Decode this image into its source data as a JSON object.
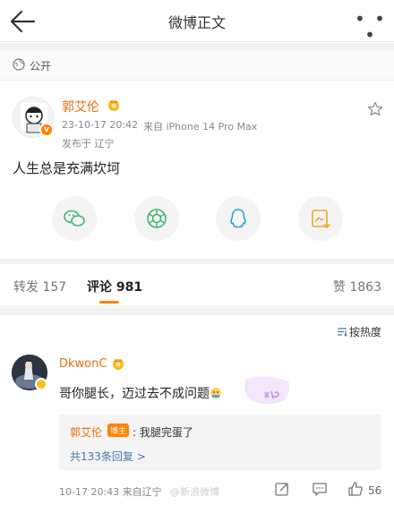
{
  "navbar": {
    "title": "微博正文",
    "more": "• • •"
  },
  "visibility": {
    "label": "公开"
  },
  "post": {
    "author": "郭艾伦",
    "time": "23-10-17 20:42",
    "source": "来自 iPhone 14 Pro Max",
    "location": "发布于 辽宁",
    "text": "人生总是充满坎坷",
    "share_icons": [
      "wechat-icon",
      "moments-icon",
      "qq-icon",
      "album-icon"
    ]
  },
  "tabs": {
    "repost": "转发 157",
    "comments": "评论 981",
    "likes": "赞 1863"
  },
  "sort": {
    "label": "按热度"
  },
  "comment": {
    "author": "DkwonC",
    "text": "哥你腿长，迈过去不成问题",
    "reply": {
      "author": "郭艾伦",
      "badge": "博主",
      "text": ": 我腿完蛋了",
      "more": "共133条回复 >"
    },
    "time": "10-17 20:43 来自辽宁",
    "watermark": "@新浪微博",
    "likes": "56"
  },
  "colors": {
    "accent": "#ff8200",
    "name": "#e86d0c",
    "link": "#4a7aa8"
  }
}
